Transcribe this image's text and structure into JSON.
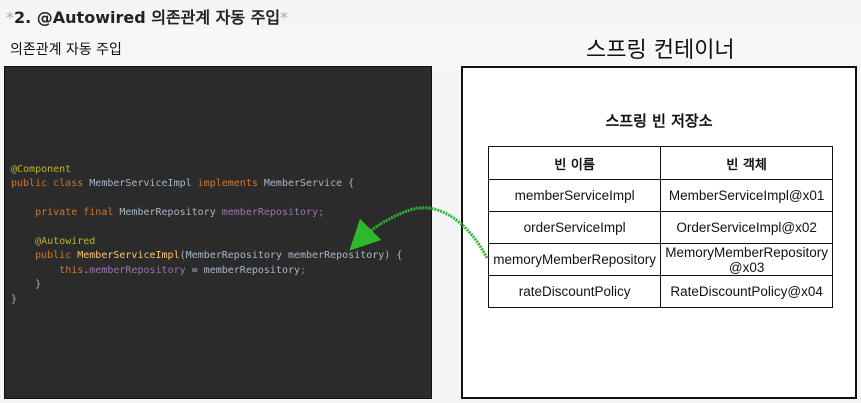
{
  "heading": {
    "star_left": "*",
    "text": "2. @Autowired 의존관계 자동 주입",
    "star_right": "*"
  },
  "left_title": "의존관계 자동 주입",
  "right_title": "스프링 컨테이너",
  "code": {
    "lines": [
      [
        [
          "ann",
          "@Component"
        ]
      ],
      [
        [
          "kw",
          "public class "
        ],
        [
          "plain",
          "MemberServiceImpl "
        ],
        [
          "kw",
          "implements "
        ],
        [
          "plain",
          "MemberService {"
        ]
      ],
      [
        [
          "plain",
          ""
        ]
      ],
      [
        [
          "plain",
          "    "
        ],
        [
          "kw",
          "private final "
        ],
        [
          "plain",
          "MemberRepository "
        ],
        [
          "fld",
          "memberRepository"
        ],
        [
          "kw",
          ";"
        ]
      ],
      [
        [
          "plain",
          ""
        ]
      ],
      [
        [
          "plain",
          "    "
        ],
        [
          "ann",
          "@Autowired"
        ]
      ],
      [
        [
          "plain",
          "    "
        ],
        [
          "kw",
          "public "
        ],
        [
          "fn",
          "MemberServiceImpl"
        ],
        [
          "plain",
          "(MemberRepository memberRepository) {"
        ]
      ],
      [
        [
          "plain",
          "        "
        ],
        [
          "kw",
          "this"
        ],
        [
          "plain",
          "."
        ],
        [
          "fld",
          "memberRepository"
        ],
        [
          "plain",
          " = memberRepository"
        ],
        [
          "kw",
          ";"
        ]
      ],
      [
        [
          "plain",
          "    }"
        ]
      ],
      [
        [
          "plain",
          "}"
        ]
      ]
    ]
  },
  "container": {
    "title": "스프링 빈 저장소",
    "headers": [
      "빈 이름",
      "빈 객체"
    ],
    "rows": [
      [
        "memberServiceImpl",
        "MemberServiceImpl@x01"
      ],
      [
        "orderServiceImpl",
        "OrderServiceImpl@x02"
      ],
      [
        "memoryMemberRepository",
        "MemoryMemberRepository\n@x03"
      ],
      [
        "rateDiscountPolicy",
        "RateDiscountPolicy@x04"
      ]
    ]
  },
  "colors": {
    "code_bg": "#2b2b2b",
    "annotation": "#bbb529",
    "keyword": "#cc7832",
    "field": "#9876aa",
    "method": "#ffc66d",
    "arrow": "#2eb82e"
  },
  "icons": {
    "arrow": "green-curved-arrow"
  }
}
